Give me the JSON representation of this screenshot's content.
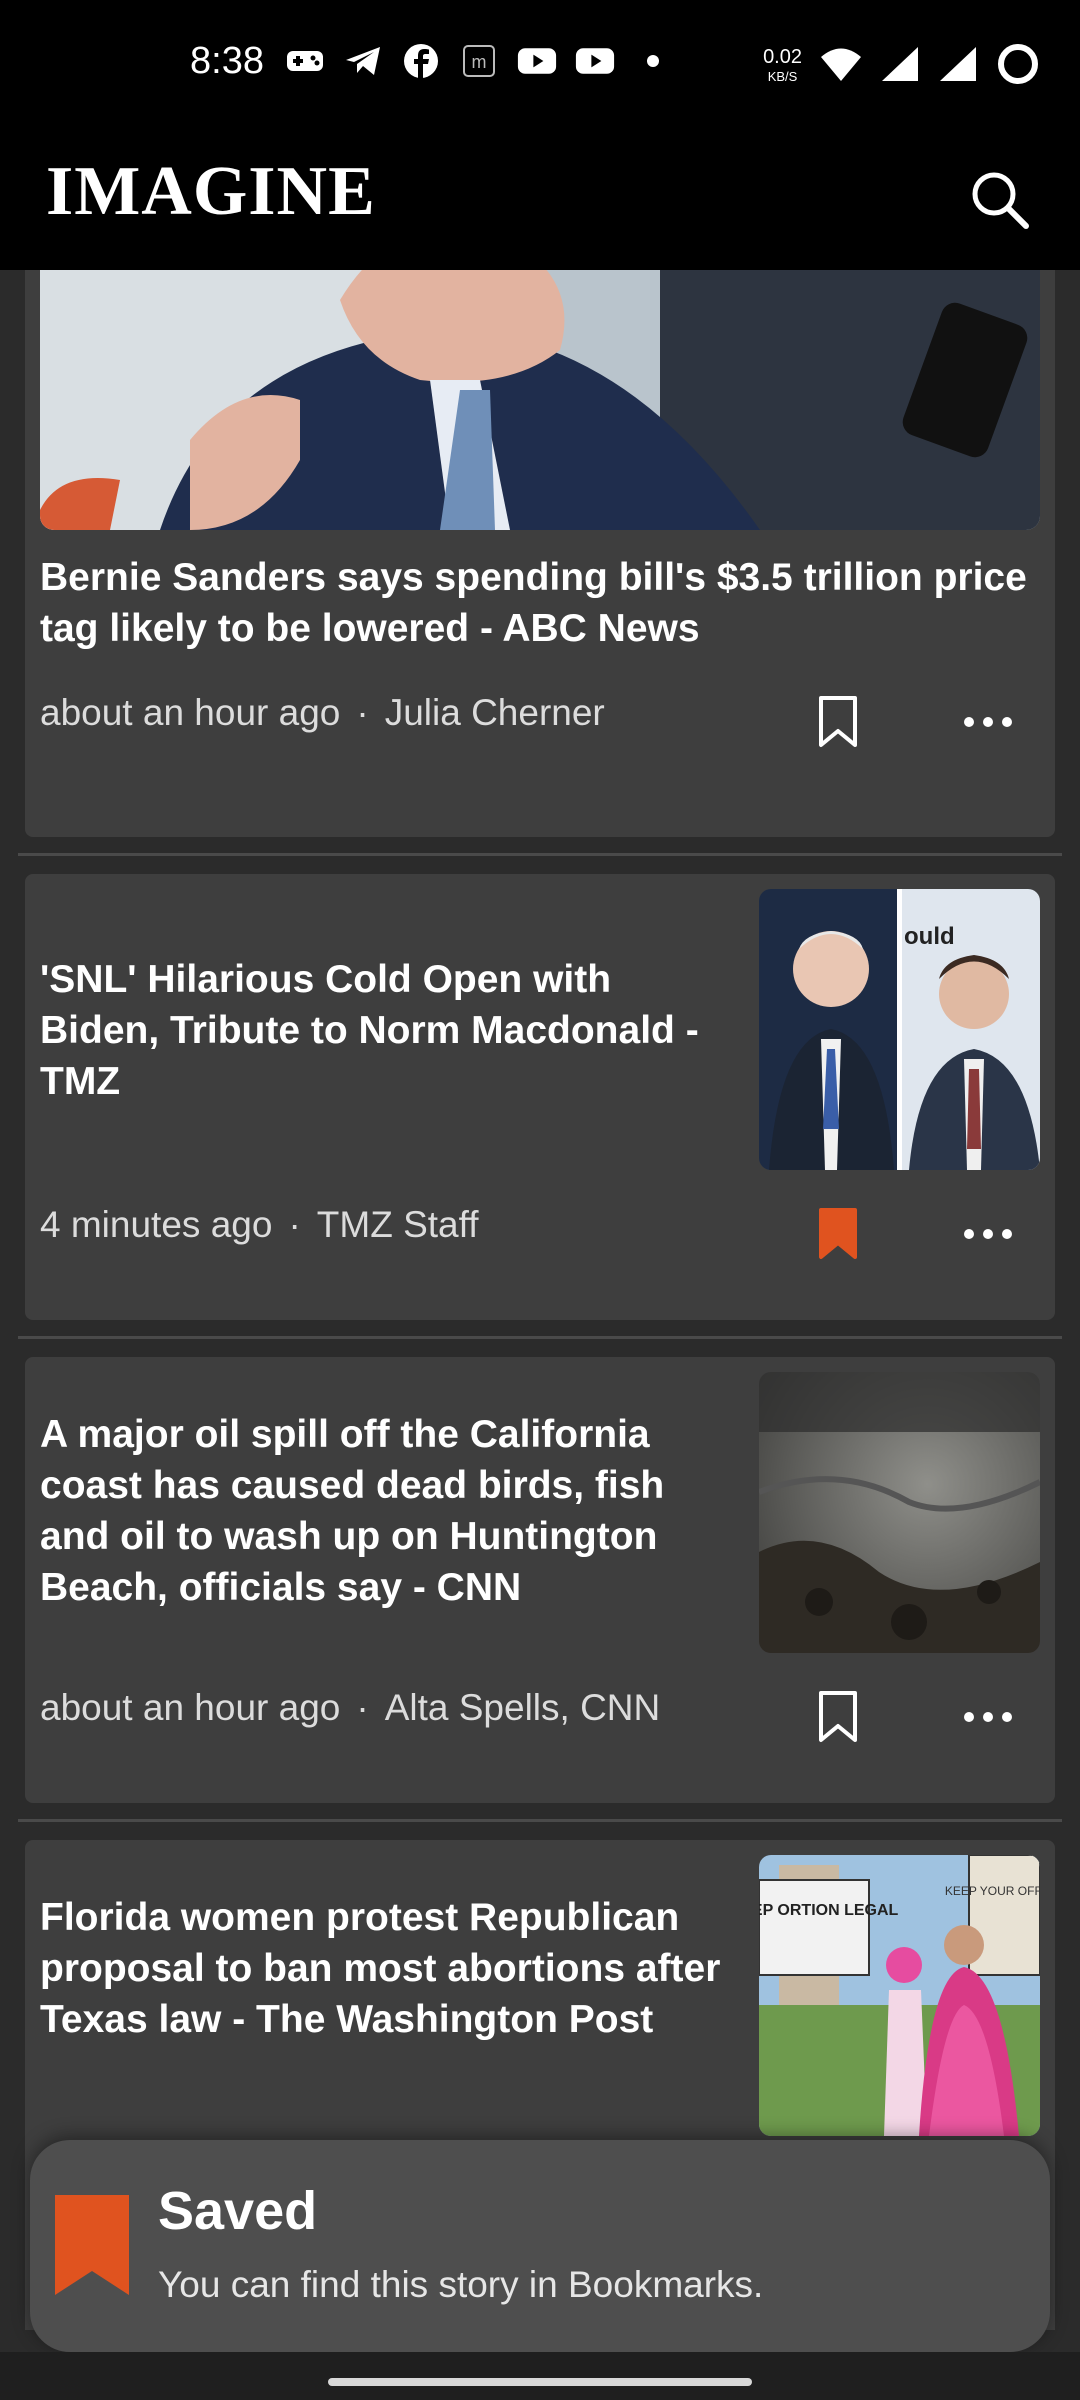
{
  "status": {
    "time": "8:38",
    "net_speed": "0.02",
    "net_unit": "KB/S",
    "icons": [
      "game-controller-icon",
      "telegram-icon",
      "facebook-icon",
      "m-icon",
      "youtube-icon",
      "youtube-icon",
      "dot-icon"
    ]
  },
  "app": {
    "title": "IMAGINE"
  },
  "articles": [
    {
      "title": "Bernie Sanders says spending bill's $3.5 trillion price tag likely to be lowered - ABC News",
      "time": "about an hour ago",
      "author": "Julia Cherner",
      "bookmarked": false
    },
    {
      "title": "'SNL' Hilarious Cold Open with Biden, Tribute to Norm Macdonald - TMZ",
      "time": "4 minutes ago",
      "author": "TMZ Staff",
      "bookmarked": true,
      "thumb_text": "ould"
    },
    {
      "title": "A major oil spill off the California coast has caused dead birds, fish and oil to wash up on Huntington Beach, officials say - CNN",
      "time": "about an hour ago",
      "author": "Alta Spells, CNN",
      "bookmarked": false
    },
    {
      "title": "Florida women protest Republican proposal to ban most abortions after Texas law - The Washington Post",
      "thumb_sign1": "KEEP ORTION LEGAL",
      "thumb_sign2": "KEEP YOUR OFF MY"
    }
  ],
  "meta_separator": "·",
  "snackbar": {
    "title": "Saved",
    "message": "You can find this story in Bookmarks."
  },
  "colors": {
    "accent": "#e0531f",
    "card": "#3e3e3e",
    "background": "#2b2b2b"
  }
}
